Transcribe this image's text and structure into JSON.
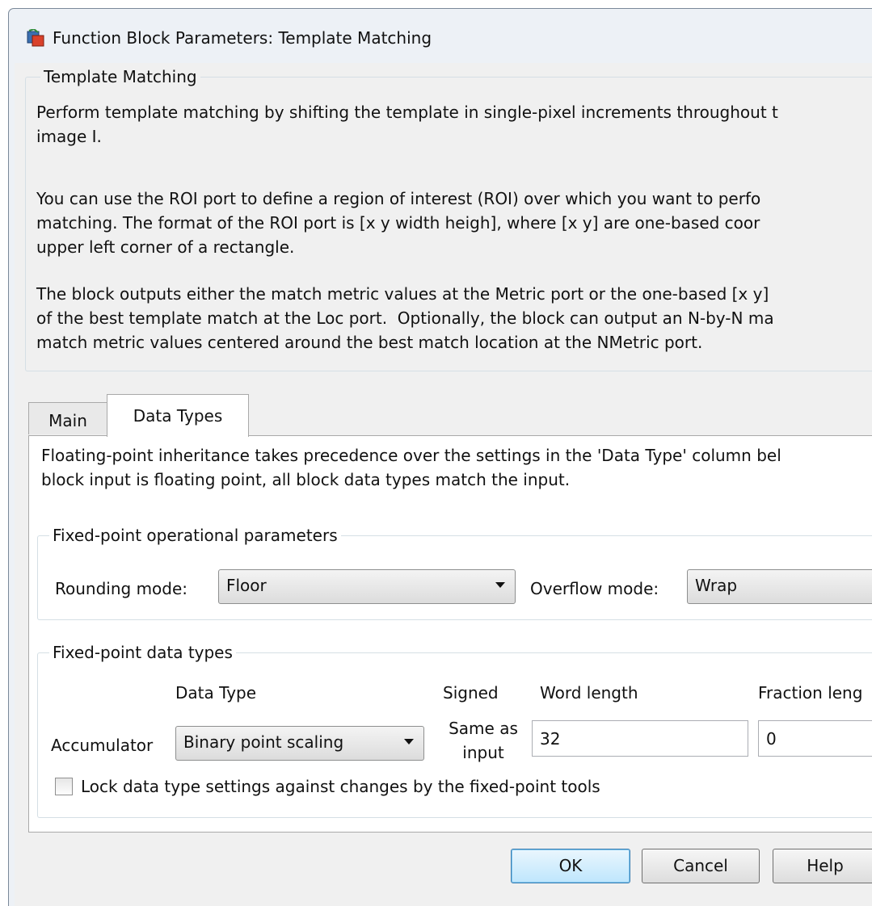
{
  "window": {
    "title": "Function Block Parameters: Template Matching",
    "icon": "simulink-block-icon"
  },
  "description": {
    "group_title": "Template Matching",
    "paragraphs": [
      [
        "Perform template matching by shifting the template in single-pixel increments throughout t",
        "image I."
      ],
      [
        "You can use the ROI port to define a region of interest (ROI) over which you want to perfo",
        "matching. The format of the ROI port is [x y width heigh], where [x y] are one-based coor",
        "upper left corner of a rectangle."
      ],
      [
        "The block outputs either the match metric values at the Metric port or the one-based [x y]",
        "of the best template match at the Loc port.  Optionally, the block can output an N-by-N ma",
        "match metric values centered around the best match location at the NMetric port."
      ]
    ]
  },
  "tabs": [
    {
      "label": "Main",
      "selected": false
    },
    {
      "label": "Data Types",
      "selected": true
    }
  ],
  "data_types_tab": {
    "intro": [
      "Floating-point inheritance takes precedence over the settings in the 'Data Type' column bel",
      "block input is floating point, all block data types match the input."
    ],
    "operational": {
      "group_title": "Fixed-point operational parameters",
      "rounding_label": "Rounding mode:",
      "rounding_value": "Floor",
      "overflow_label": "Overflow mode:",
      "overflow_value": "Wrap"
    },
    "data_types": {
      "group_title": "Fixed-point data types",
      "headers": {
        "data_type": "Data Type",
        "signed": "Signed",
        "word_length": "Word length",
        "fraction_length": "Fraction leng"
      },
      "rows": [
        {
          "name": "Accumulator",
          "data_type": "Binary point scaling",
          "signed_line1": "Same as",
          "signed_line2": "input",
          "word_length": "32",
          "fraction_length": "0"
        }
      ],
      "lock_label": "Lock data type settings against changes by the fixed-point tools",
      "lock_checked": false
    }
  },
  "buttons": {
    "ok": "OK",
    "cancel": "Cancel",
    "help": "Help"
  }
}
